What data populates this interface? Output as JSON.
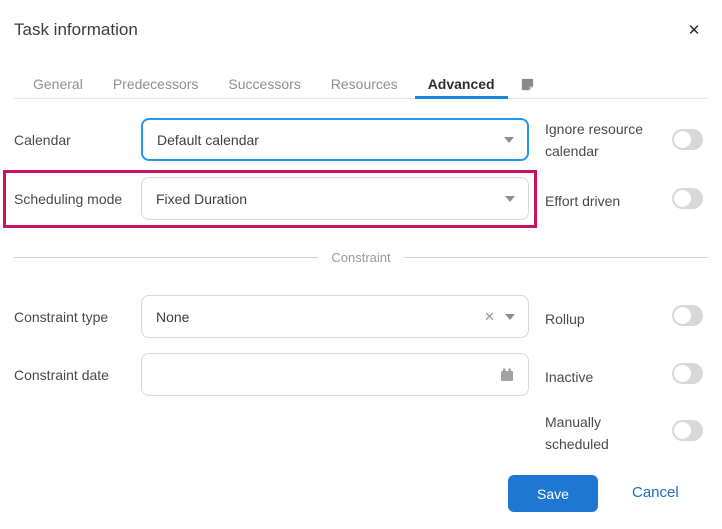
{
  "colors": {
    "tab_underline_blue": "#1a86da",
    "focused_field_border": "#2196f3",
    "save_button_blue": "#1e78d2",
    "cancel_link_blue": "#1c6fc4",
    "annotation_highlight": "#c81458",
    "toggle_track_gray": "#d8d8d8"
  },
  "dialog": {
    "title": "Task information",
    "close_icon": "✕"
  },
  "tabs": {
    "items": [
      {
        "label": "General"
      },
      {
        "label": "Predecessors"
      },
      {
        "label": "Successors"
      },
      {
        "label": "Resources"
      },
      {
        "label": "Advanced"
      }
    ],
    "active_tab": "Advanced",
    "note_tab_icon": "sticky-note"
  },
  "form": {
    "calendar": {
      "label": "Calendar",
      "value": "Default calendar",
      "state": "focused"
    },
    "scheduling_mode": {
      "label": "Scheduling mode",
      "value": "Fixed Duration",
      "state": "highlighted"
    },
    "constraint_section_label": "Constraint",
    "constraint_type": {
      "label": "Constraint type",
      "value": "None",
      "clear_icon": "✕"
    },
    "constraint_date": {
      "label": "Constraint date",
      "value": ""
    },
    "toggles": [
      {
        "label": "Ignore resource calendar",
        "state": "off"
      },
      {
        "label": "Effort driven",
        "state": "off"
      },
      {
        "label": "Rollup",
        "state": "off"
      },
      {
        "label": "Inactive",
        "state": "off"
      },
      {
        "label": "Manually scheduled",
        "state": "off"
      }
    ]
  },
  "footer": {
    "save": "Save",
    "cancel": "Cancel"
  }
}
